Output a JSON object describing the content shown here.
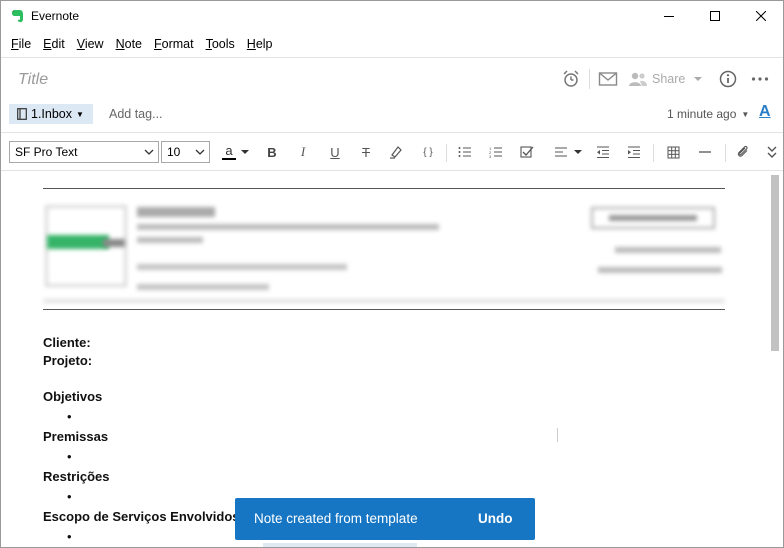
{
  "window": {
    "title": "Evernote",
    "brand_color": "#2dbe60"
  },
  "menu": [
    {
      "label": "File",
      "u": "F",
      "rest": "ile"
    },
    {
      "label": "Edit",
      "u": "E",
      "rest": "dit"
    },
    {
      "label": "View",
      "u": "V",
      "rest": "iew"
    },
    {
      "label": "Note",
      "u": "N",
      "rest": "ote"
    },
    {
      "label": "Format",
      "u": "F",
      "rest": "ormat"
    },
    {
      "label": "Tools",
      "u": "T",
      "rest": "ools"
    },
    {
      "label": "Help",
      "u": "H",
      "rest": "elp"
    }
  ],
  "note": {
    "title_placeholder": "Title",
    "share_label": "Share",
    "notebook": "1.Inbox",
    "add_tag_placeholder": "Add tag...",
    "updated": "1 minute ago"
  },
  "toolbar": {
    "font": "SF Pro Text",
    "size": "10",
    "text_color_glyph": "a",
    "bold": "B",
    "italic": "I",
    "underline": "U",
    "strike": "T",
    "code": "{ }"
  },
  "document": {
    "lines": [
      {
        "text": "Cliente:",
        "kind": "label"
      },
      {
        "text": "Projeto:",
        "kind": "label"
      },
      {
        "text": "Objetivos",
        "kind": "label"
      },
      {
        "text": "•",
        "kind": "bullet"
      },
      {
        "text": "Premissas",
        "kind": "label"
      },
      {
        "text": "•",
        "kind": "bullet"
      },
      {
        "text": "Restrições",
        "kind": "label"
      },
      {
        "text": "•",
        "kind": "bullet"
      },
      {
        "text": "Escopo de Serviços Envolvidos",
        "kind": "label"
      },
      {
        "text": "•",
        "kind": "bullet"
      }
    ]
  },
  "toast": {
    "message": "Note created from template",
    "action": "Undo",
    "color": "#1676c4"
  },
  "colors": {
    "accent": "#2a7ec8",
    "chip_bg": "#dce8f3"
  }
}
